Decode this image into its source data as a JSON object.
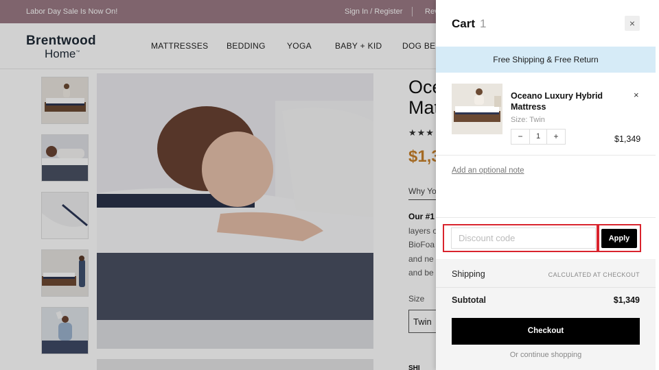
{
  "topbar": {
    "promo": "Labor Day Sale Is Now On!",
    "signin": "Sign In / Register",
    "reviews": "Rev"
  },
  "logo": {
    "line1": "Brentwood",
    "line2": "Home",
    "tm": "™"
  },
  "nav": [
    "MATTRESSES",
    "BEDDING",
    "YOGA",
    "BABY + KID",
    "DOG BED"
  ],
  "product": {
    "title_line1": "Oce",
    "title_line2": "Mat",
    "stars": "★★★",
    "price": "$1,3",
    "why_tab": "Why Yo",
    "desc_bold": "Our #1",
    "desc_lines": [
      "layers o",
      "BioFoa",
      "and ne",
      "and be"
    ],
    "size_label": "Size",
    "size_value": "Twin",
    "ship_partial": "SHI"
  },
  "cart": {
    "title": "Cart",
    "count": "1",
    "close_glyph": "×",
    "banner": "Free Shipping & Free Return",
    "item": {
      "name": "Oceano Luxury Hybrid Mattress",
      "size": "Size: Twin",
      "qty_minus": "−",
      "qty": "1",
      "qty_plus": "+",
      "price": "$1,349",
      "remove_glyph": "×"
    },
    "note_link": "Add an optional note",
    "discount_placeholder": "Discount code",
    "apply_label": "Apply",
    "shipping_label": "Shipping",
    "shipping_value": "CALCULATED AT CHECKOUT",
    "subtotal_label": "Subtotal",
    "subtotal_value": "$1,349",
    "checkout_label": "Checkout",
    "continue_label": "Or continue shopping"
  },
  "colors": {
    "topbar": "#9c7b85",
    "banner": "#d6ebf7",
    "price_accent": "#c8822d",
    "highlight": "#d9232d"
  }
}
